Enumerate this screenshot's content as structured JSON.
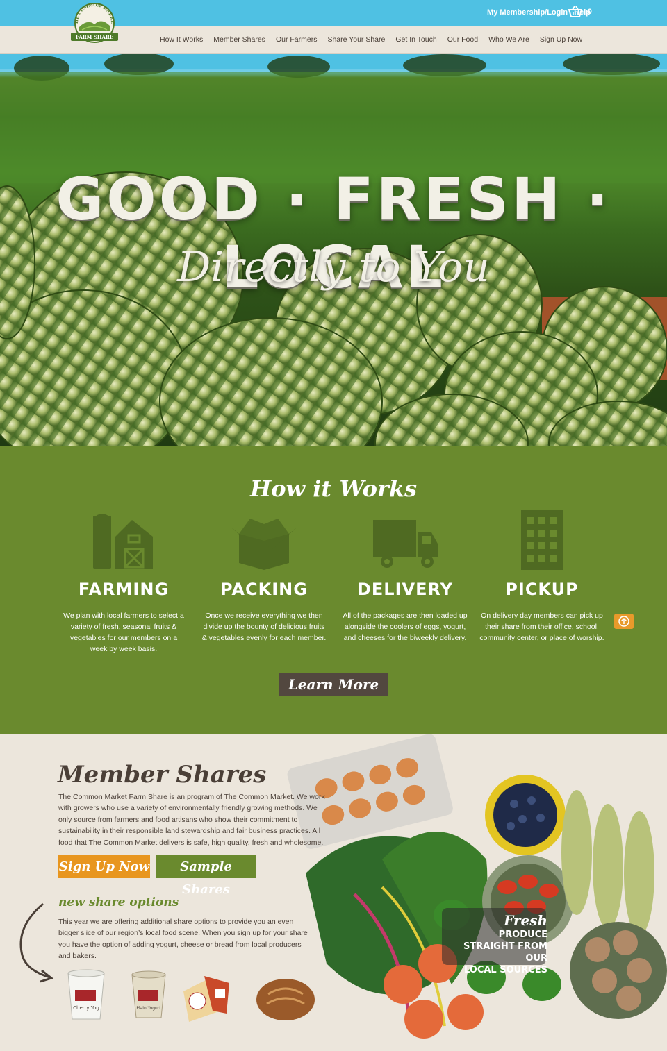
{
  "header": {
    "logo": {
      "line1": "THE COMMON MARKET",
      "line2": "FARM SHARE"
    },
    "login": "My Membership/Login",
    "help": "Help",
    "cart_count": "0",
    "nav": [
      "How It Works",
      "Member Shares",
      "Our Farmers",
      "Share Your Share",
      "Get In Touch",
      "Our Food",
      "Who We Are",
      "Sign Up Now"
    ]
  },
  "hero": {
    "title": "GOOD · FRESH · LOCAL",
    "subtitle": "Directly to You"
  },
  "how": {
    "title": "How it Works",
    "steps": [
      {
        "title": "FARMING",
        "text": "We plan with local farmers to select a variety of fresh, seasonal fruits & vegetables for our members on a week by week basis.",
        "icon": "barn-icon"
      },
      {
        "title": "PACKING",
        "text": "Once we receive everything we then divide up the bounty of delicious fruits & vegetables evenly for each member.",
        "icon": "box-icon"
      },
      {
        "title": "DELIVERY",
        "text": "All of the packages are then loaded up alongside the coolers of eggs, yogurt, and cheeses for the biweekly delivery.",
        "icon": "truck-icon"
      },
      {
        "title": "PICKUP",
        "text": "On delivery day members can pick up their share from their office, school, community center, or place of worship.",
        "icon": "building-icon"
      }
    ],
    "learn_more": "Learn More"
  },
  "shares": {
    "title": "Member Shares",
    "intro": "The Common Market Farm Share is an program of The Common Market. We work with growers who use a variety of environmentally friendly growing methods. We only source from farmers and food artisans who show their commitment to sustainability in their responsible land stewardship and fair business practices. All food that The Common Market delivers is safe, high quality, fresh and wholesome.",
    "signup": "Sign Up Now",
    "sample": "Sample Shares",
    "options_title": "new share options",
    "options_text": "This year we are offering additional share options to provide you an even bigger slice of our region’s local food scene. When you sign up for your share you have the option of adding yogurt, cheese or bread from local producers and bakers.",
    "yogurt1_label": "Cherry Yog",
    "yogurt2_label": "Plain Yogurt",
    "badge": {
      "fresh": "Fresh",
      "line1": "PRODUCE",
      "line2": "STRAIGHT FROM OUR",
      "line3": "LOCAL SOURCES"
    }
  },
  "colors": {
    "sky": "#4fc1e3",
    "green": "#6a8a2e",
    "orange": "#e8961f",
    "brown": "#52473f",
    "cream": "#ece6dc"
  }
}
